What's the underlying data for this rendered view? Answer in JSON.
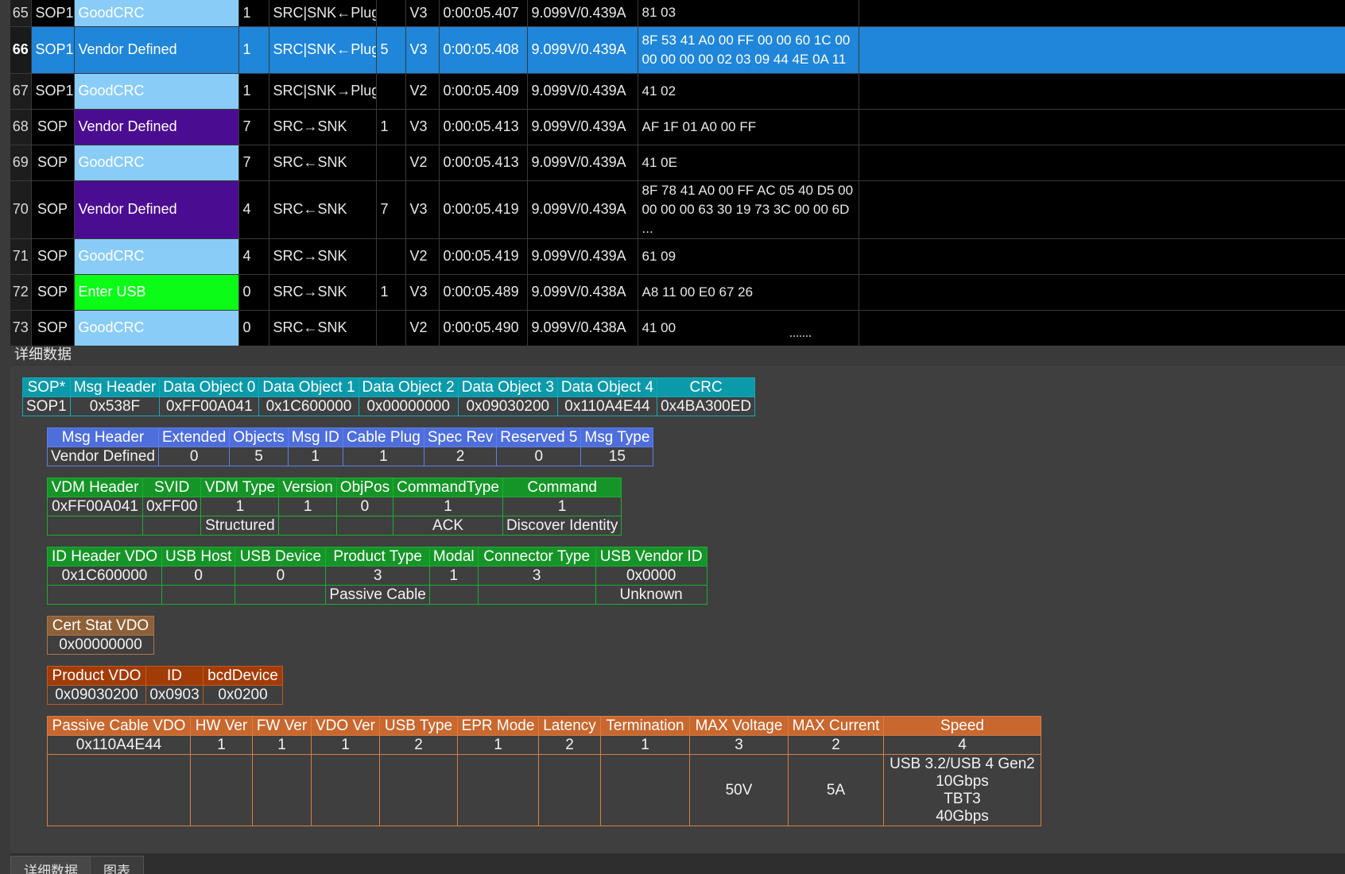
{
  "packets": [
    {
      "idx": "65",
      "sop": "SOP1",
      "type": "GoodCRC",
      "type_class": "t-goodcrc",
      "id": "1",
      "direction": "SRC|SNK←Plug",
      "objects": "",
      "rev": "V3",
      "time": "0:00:05.407",
      "vbus": "9.099V/0.439A",
      "payload": "81 03"
    },
    {
      "idx": "66",
      "sop": "SOP1",
      "type": "Vendor Defined",
      "type_class": "t-vendor-sel",
      "id": "1",
      "direction": "SRC|SNK←Plug",
      "objects": "5",
      "rev": "V3",
      "time": "0:00:05.408",
      "vbus": "9.099V/0.439A",
      "payload": "8F 53 41 A0 00 FF 00 00 60 1C 00 00 00 00 00 02 03 09 44 4E 0A 11"
    },
    {
      "idx": "67",
      "sop": "SOP1",
      "type": "GoodCRC",
      "type_class": "t-goodcrc",
      "id": "1",
      "direction": "SRC|SNK→Plug",
      "objects": "",
      "rev": "V2",
      "time": "0:00:05.409",
      "vbus": "9.099V/0.439A",
      "payload": "41 02"
    },
    {
      "idx": "68",
      "sop": "SOP",
      "type": "Vendor Defined",
      "type_class": "t-vendor",
      "id": "7",
      "direction": "SRC→SNK",
      "objects": "1",
      "rev": "V3",
      "time": "0:00:05.413",
      "vbus": "9.099V/0.439A",
      "payload": "AF 1F 01 A0 00 FF"
    },
    {
      "idx": "69",
      "sop": "SOP",
      "type": "GoodCRC",
      "type_class": "t-goodcrc",
      "id": "7",
      "direction": "SRC←SNK",
      "objects": "",
      "rev": "V2",
      "time": "0:00:05.413",
      "vbus": "9.099V/0.439A",
      "payload": "41 0E"
    },
    {
      "idx": "70",
      "sop": "SOP",
      "type": "Vendor Defined",
      "type_class": "t-vendor",
      "id": "4",
      "direction": "SRC←SNK",
      "objects": "7",
      "rev": "V3",
      "time": "0:00:05.419",
      "vbus": "9.099V/0.439A",
      "payload": "8F 78 41 A0 00 FF AC 05 40 D5 00 00 00 00 63 30 19 73 3C 00 00 6D ..."
    },
    {
      "idx": "71",
      "sop": "SOP",
      "type": "GoodCRC",
      "type_class": "t-goodcrc",
      "id": "4",
      "direction": "SRC→SNK",
      "objects": "",
      "rev": "V2",
      "time": "0:00:05.419",
      "vbus": "9.099V/0.439A",
      "payload": "61 09"
    },
    {
      "idx": "72",
      "sop": "SOP",
      "type": "Enter USB",
      "type_class": "t-enterusb",
      "id": "0",
      "direction": "SRC→SNK",
      "objects": "1",
      "rev": "V3",
      "time": "0:00:05.489",
      "vbus": "9.099V/0.438A",
      "payload": "A8 11 00 E0 67 26"
    },
    {
      "idx": "73",
      "sop": "SOP",
      "type": "GoodCRC",
      "type_class": "t-goodcrc",
      "id": "0",
      "direction": "SRC←SNK",
      "objects": "",
      "rev": "V2",
      "time": "0:00:05.490",
      "vbus": "9.099V/0.438A",
      "payload": "41 00"
    }
  ],
  "selected_packet": "66",
  "panel_title": "详细数据",
  "detail": {
    "raw": {
      "headers": [
        "SOP*",
        "Msg Header",
        "Data Object 0",
        "Data Object 1",
        "Data Object 2",
        "Data Object 3",
        "Data Object 4",
        "CRC"
      ],
      "values": [
        "SOP1",
        "0x538F",
        "0xFF00A041",
        "0x1C600000",
        "0x00000000",
        "0x09030200",
        "0x110A4E44",
        "0x4BA300ED"
      ]
    },
    "msg_header": {
      "headers": [
        "Msg Header",
        "Extended",
        "Objects",
        "Msg ID",
        "Cable Plug",
        "Spec Rev",
        "Reserved 5",
        "Msg Type"
      ],
      "values": [
        "Vendor Defined",
        "0",
        "5",
        "1",
        "1",
        "2",
        "0",
        "15"
      ]
    },
    "vdm_header": {
      "headers": [
        "VDM Header",
        "SVID",
        "VDM Type",
        "Version",
        "ObjPos",
        "CommandType",
        "Command"
      ],
      "values": [
        "0xFF00A041",
        "0xFF00",
        "1",
        "1",
        "0",
        "1",
        "1"
      ],
      "decoded": [
        "",
        "",
        "Structured",
        "",
        "",
        "ACK",
        "Discover Identity"
      ]
    },
    "id_header": {
      "headers": [
        "ID Header VDO",
        "USB Host",
        "USB Device",
        "Product Type",
        "Modal",
        "Connector Type",
        "USB Vendor ID"
      ],
      "values": [
        "0x1C600000",
        "0",
        "0",
        "3",
        "1",
        "3",
        "0x0000"
      ],
      "decoded": [
        "",
        "",
        "",
        "Passive Cable",
        "",
        "",
        "Unknown"
      ]
    },
    "cert_stat": {
      "headers": [
        "Cert Stat VDO"
      ],
      "values": [
        "0x00000000"
      ]
    },
    "product": {
      "headers": [
        "Product VDO",
        "ID",
        "bcdDevice"
      ],
      "values": [
        "0x09030200",
        "0x0903",
        "0x0200"
      ]
    },
    "passive_cable": {
      "headers": [
        "Passive Cable VDO",
        "HW Ver",
        "FW Ver",
        "VDO Ver",
        "USB Type",
        "EPR Mode",
        "Latency",
        "Termination",
        "MAX Voltage",
        "MAX Current",
        "Speed"
      ],
      "values": [
        "0x110A4E44",
        "1",
        "1",
        "1",
        "2",
        "1",
        "2",
        "1",
        "3",
        "2",
        "4"
      ],
      "decoded": [
        "",
        "",
        "",
        "",
        "",
        "",
        "",
        "",
        "50V",
        "5A",
        "USB 3.2/USB 4 Gen2\n10Gbps\nTBT3\n40Gbps"
      ]
    }
  },
  "tabs": [
    {
      "label": "详细数据",
      "active": true
    },
    {
      "label": "图表",
      "active": false
    }
  ]
}
